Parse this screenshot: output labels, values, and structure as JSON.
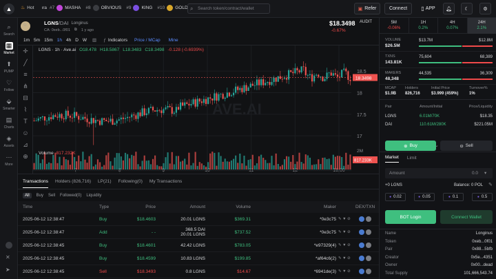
{
  "topbar": {
    "hot_label": "Hot",
    "hot2": "ıra",
    "trending": [
      {
        "rank": "#7",
        "name": "MASHA",
        "color": "#c246d9"
      },
      {
        "rank": "#8",
        "name": "OBVIOUS",
        "color": "#3a3c41"
      },
      {
        "rank": "#9",
        "name": "KING",
        "color": "#7a4fe0"
      },
      {
        "rank": "#10",
        "name": "GOLD",
        "color": "#d9a72a"
      }
    ],
    "search_placeholder": "Search token/contract/wallet",
    "refer": "Refer",
    "connect": "Connect",
    "app": "APP"
  },
  "sidebar": [
    {
      "name": "search",
      "label": "Search",
      "icon": "⌕"
    },
    {
      "name": "market",
      "label": "Market",
      "icon": "▦",
      "active": true
    },
    {
      "name": "pump",
      "label": "PUMP",
      "icon": "⬆"
    },
    {
      "name": "follow",
      "label": "Follow",
      "icon": "♡"
    },
    {
      "name": "smarter",
      "label": "Smarter",
      "icon": "⬙"
    },
    {
      "name": "charts",
      "label": "Charts",
      "icon": "▤"
    },
    {
      "name": "assets",
      "label": "Assets",
      "icon": "◈"
    },
    {
      "name": "more",
      "label": "More",
      "icon": "⋯"
    }
  ],
  "token": {
    "symbol": "LGNS",
    "pair": "/DAI",
    "name": "Longinus",
    "ca": "CA: 0xeb...0f01",
    "age": "1 y ago",
    "price": "$18.3498",
    "change": "-0.67%",
    "audit": "AUDIT"
  },
  "chart_tools": {
    "intervals": [
      "1m",
      "5m",
      "15m",
      "1h",
      "4h",
      "D",
      "W"
    ],
    "active": "1h",
    "indicators": "Indicators",
    "price_mcap": "Price / MCap",
    "mine": "Mine"
  },
  "chart_data": {
    "type": "candlestick",
    "title": "LGNS · 1h · Ave.ai",
    "ohlc_label": {
      "o": "O18.478",
      "h": "H18.5867",
      "l": "L18.3483",
      "c": "C18.3498",
      "chg": "-0.128 (-0.6939%)"
    },
    "y_ticks": [
      "18.5",
      "18",
      "17.5",
      "17"
    ],
    "last_price": "18.3498",
    "volume_label": "Volume",
    "volume_value": "817.232K",
    "volume_axis": "2M",
    "volume_last": "817.233K",
    "x_ticks": [
      "7",
      "8",
      "9",
      "10",
      "11",
      "12",
      "18:00"
    ],
    "ylim": [
      16.7,
      18.9
    ],
    "watermark": "AVE.AI"
  },
  "tx_tabs": [
    "Transactions",
    "Holders (826,716)",
    "LP(21)",
    "Following(0)",
    "My Transactions"
  ],
  "filters": [
    "All",
    "Buy",
    "Sell",
    "Followed(0)",
    "Liquidity"
  ],
  "columns": [
    "Time",
    "Type",
    "Price",
    "Amount",
    "Volume",
    "Maker",
    "DEX/TXN"
  ],
  "transactions": [
    {
      "time": "2025-06-12 12:38:47",
      "type": "Buy",
      "cls": "buy",
      "price": "$18.4603",
      "amount": "20.01 LGNS",
      "amount2": "",
      "volume": "$369.31",
      "maker": "*0e3c75"
    },
    {
      "time": "2025-06-12 12:38:47",
      "type": "Add",
      "cls": "buy",
      "price": "- -",
      "amount": "368.5 DAI",
      "amount2": "20.01 LGNS",
      "volume": "$737.52",
      "maker": "*0e3c75"
    },
    {
      "time": "2025-06-12 12:38:45",
      "type": "Buy",
      "cls": "buy",
      "price": "$18.4601",
      "amount": "42.42 LGNS",
      "amount2": "",
      "volume": "$783.05",
      "maker": "*e97329(4)"
    },
    {
      "time": "2025-06-12 12:38:45",
      "type": "Buy",
      "cls": "buy",
      "price": "$18.4599",
      "amount": "10.83 LGNS",
      "amount2": "",
      "volume": "$199.85",
      "maker": "*af64c6(2)"
    },
    {
      "time": "2025-06-12 12:38:45",
      "type": "Sell",
      "cls": "sell",
      "price": "$18.3493",
      "amount": "0.8 LGNS",
      "amount2": "",
      "volume": "$14.67",
      "maker": "*6941de(3)"
    }
  ],
  "timeframes": [
    {
      "label": "5M",
      "pct": "-0.06%",
      "cls": "sell"
    },
    {
      "label": "1H",
      "pct": "0.2%",
      "cls": "buy"
    },
    {
      "label": "4H",
      "pct": "0.07%",
      "cls": "buy"
    },
    {
      "label": "24H",
      "pct": "2.1%",
      "cls": "buy",
      "active": true
    }
  ],
  "stats": [
    {
      "label": "VOLUME",
      "value": "$26.5M",
      "left": "$13.7M",
      "right": "$12.8M"
    },
    {
      "label": "TXNS",
      "value": "143.81K",
      "left": "75,604",
      "right": "68,389"
    },
    {
      "label": "MAKERS",
      "value": "48,348",
      "left": "44,535",
      "right": "36,309"
    }
  ],
  "metrics": [
    {
      "label": "MCAP",
      "value": "$1.9B"
    },
    {
      "label": "Holders",
      "value": "826,716"
    },
    {
      "label": "Initial Price",
      "value": "$3.999 (459%)"
    },
    {
      "label": "Turnover%",
      "value": "1%"
    }
  ],
  "pool": {
    "headers": [
      "Pair",
      "Amount/Initial",
      "Price/Liquidity"
    ],
    "rows": [
      {
        "sym": "LGNS",
        "amt": "6.01M/70K",
        "price": "$18.35"
      },
      {
        "sym": "DAI",
        "amt": "110.61M/280K",
        "price": "$221.05M"
      }
    ]
  },
  "trade": {
    "buy": "Buy",
    "sell": "Sell",
    "tabs": [
      "Market",
      "Limit"
    ],
    "amount_label": "Amount",
    "amount_value": "0.0",
    "unit": "+0 LGNS",
    "balance": "Balance: 0 POL",
    "presets": [
      "0.02",
      "0.05",
      "0.1",
      "0.5"
    ],
    "bot_login": "BOT Login",
    "connect_wallet": "Connect Wallet"
  },
  "info": [
    {
      "k": "Name",
      "v": "Longinus"
    },
    {
      "k": "Token",
      "v": "0xeb...0f01"
    },
    {
      "k": "Pair",
      "v": "0x88...5bfb"
    },
    {
      "k": "Creator",
      "v": "0x5e...4351"
    },
    {
      "k": "Owner",
      "v": "0x00...dead"
    },
    {
      "k": "Total Supply",
      "v": "101,666,543.74"
    }
  ],
  "colors": {
    "up": "#26a69a",
    "down": "#ef5350",
    "accent": "#3fbf7f"
  }
}
